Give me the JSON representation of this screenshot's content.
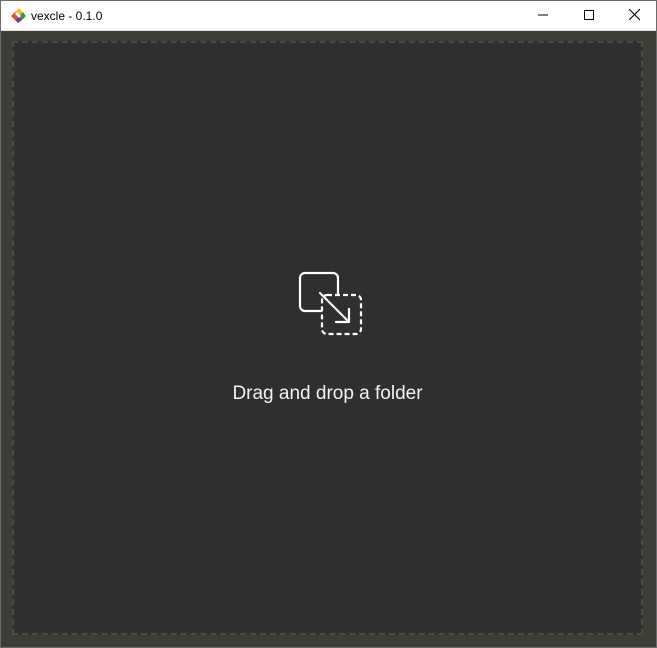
{
  "window": {
    "title": "vexcle - 0.1.0",
    "app_icon": "vexcle-logo-icon",
    "controls": {
      "minimize_icon": "minimize-icon",
      "maximize_icon": "maximize-icon",
      "close_icon": "close-icon"
    }
  },
  "dropzone": {
    "icon": "drag-drop-icon",
    "label": "Drag and drop a folder"
  },
  "colors": {
    "window_frame": "#3c3c33",
    "dropzone_bg": "#2f2f2f",
    "dropzone_border": "#4a4a4a",
    "label_text": "#f2f2f2"
  }
}
